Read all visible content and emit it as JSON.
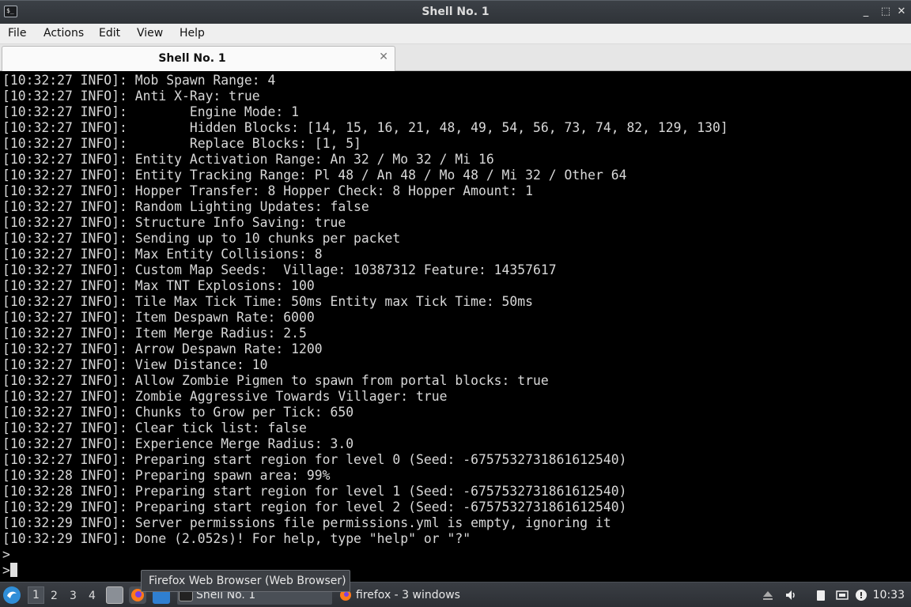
{
  "window": {
    "title": "Shell No. 1",
    "controls": {
      "minimize": "_",
      "maximize": "⬚",
      "close": "✕"
    }
  },
  "menu": {
    "items": [
      "File",
      "Actions",
      "Edit",
      "View",
      "Help"
    ]
  },
  "tabs": [
    {
      "label": "Shell No. 1",
      "close": "✕"
    }
  ],
  "terminal": {
    "lines": [
      "[10:32:27 INFO]: Mob Spawn Range: 4",
      "[10:32:27 INFO]: Anti X-Ray: true",
      "[10:32:27 INFO]:        Engine Mode: 1",
      "[10:32:27 INFO]:        Hidden Blocks: [14, 15, 16, 21, 48, 49, 54, 56, 73, 74, 82, 129, 130]",
      "[10:32:27 INFO]:        Replace Blocks: [1, 5]",
      "[10:32:27 INFO]: Entity Activation Range: An 32 / Mo 32 / Mi 16",
      "[10:32:27 INFO]: Entity Tracking Range: Pl 48 / An 48 / Mo 48 / Mi 32 / Other 64",
      "[10:32:27 INFO]: Hopper Transfer: 8 Hopper Check: 8 Hopper Amount: 1",
      "[10:32:27 INFO]: Random Lighting Updates: false",
      "[10:32:27 INFO]: Structure Info Saving: true",
      "[10:32:27 INFO]: Sending up to 10 chunks per packet",
      "[10:32:27 INFO]: Max Entity Collisions: 8",
      "[10:32:27 INFO]: Custom Map Seeds:  Village: 10387312 Feature: 14357617",
      "[10:32:27 INFO]: Max TNT Explosions: 100",
      "[10:32:27 INFO]: Tile Max Tick Time: 50ms Entity max Tick Time: 50ms",
      "[10:32:27 INFO]: Item Despawn Rate: 6000",
      "[10:32:27 INFO]: Item Merge Radius: 2.5",
      "[10:32:27 INFO]: Arrow Despawn Rate: 1200",
      "[10:32:27 INFO]: View Distance: 10",
      "[10:32:27 INFO]: Allow Zombie Pigmen to spawn from portal blocks: true",
      "[10:32:27 INFO]: Zombie Aggressive Towards Villager: true",
      "[10:32:27 INFO]: Chunks to Grow per Tick: 650",
      "[10:32:27 INFO]: Clear tick list: false",
      "[10:32:27 INFO]: Experience Merge Radius: 3.0",
      "[10:32:27 INFO]: Preparing start region for level 0 (Seed: -6757532731861612540)",
      "[10:32:28 INFO]: Preparing spawn area: 99%",
      "[10:32:28 INFO]: Preparing start region for level 1 (Seed: -6757532731861612540)",
      "[10:32:29 INFO]: Preparing start region for level 2 (Seed: -6757532731861612540)",
      "[10:32:29 INFO]: Server permissions file permissions.yml is empty, ignoring it",
      "[10:32:29 INFO]: Done (2.052s)! For help, type \"help\" or \"?\""
    ],
    "prompt_1": ">",
    "prompt_2": ">"
  },
  "taskbar": {
    "workspaces": [
      "1",
      "2",
      "3",
      "4"
    ],
    "active_workspace": "1",
    "tasks": [
      {
        "label": "Shell No. 1",
        "icon": "terminal-icon"
      },
      {
        "label": "firefox - 3 windows",
        "icon": "firefox-icon"
      }
    ],
    "clock": "10:33",
    "tooltip": "Firefox Web Browser (Web Browser)"
  }
}
